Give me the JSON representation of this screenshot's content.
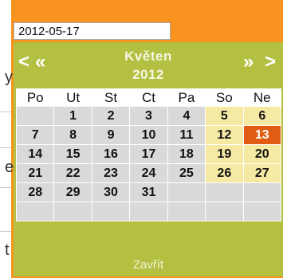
{
  "date_input": {
    "value": "2012-05-17"
  },
  "calendar": {
    "nav": {
      "prev_month": "<",
      "prev_year": "«",
      "next_year": "»",
      "next_month": ">"
    },
    "month": "Květen",
    "year": "2012",
    "weekdays": [
      "Po",
      "Ut",
      "St",
      "Ct",
      "Pa",
      "So",
      "Ne"
    ],
    "weeks": [
      [
        "",
        "1",
        "2",
        "3",
        "4",
        "5",
        "6"
      ],
      [
        "7",
        "8",
        "9",
        "10",
        "11",
        "12",
        "13"
      ],
      [
        "14",
        "15",
        "16",
        "17",
        "18",
        "19",
        "20"
      ],
      [
        "21",
        "22",
        "23",
        "24",
        "25",
        "26",
        "27"
      ],
      [
        "28",
        "29",
        "30",
        "31",
        "",
        "",
        ""
      ],
      [
        "",
        "",
        "",
        "",
        "",
        "",
        ""
      ]
    ],
    "highlighted_day": "13",
    "close_label": "Zavřít"
  },
  "colors": {
    "header_bg": "#b3c041",
    "page_bg": "#f7931e",
    "weekday_cell": "#d9d9d9",
    "weekend_cell": "#f6e9a3",
    "highlight_cell": "#e05c12"
  },
  "background_page": {
    "edge_chars": [
      "y",
      "e",
      "t"
    ]
  }
}
